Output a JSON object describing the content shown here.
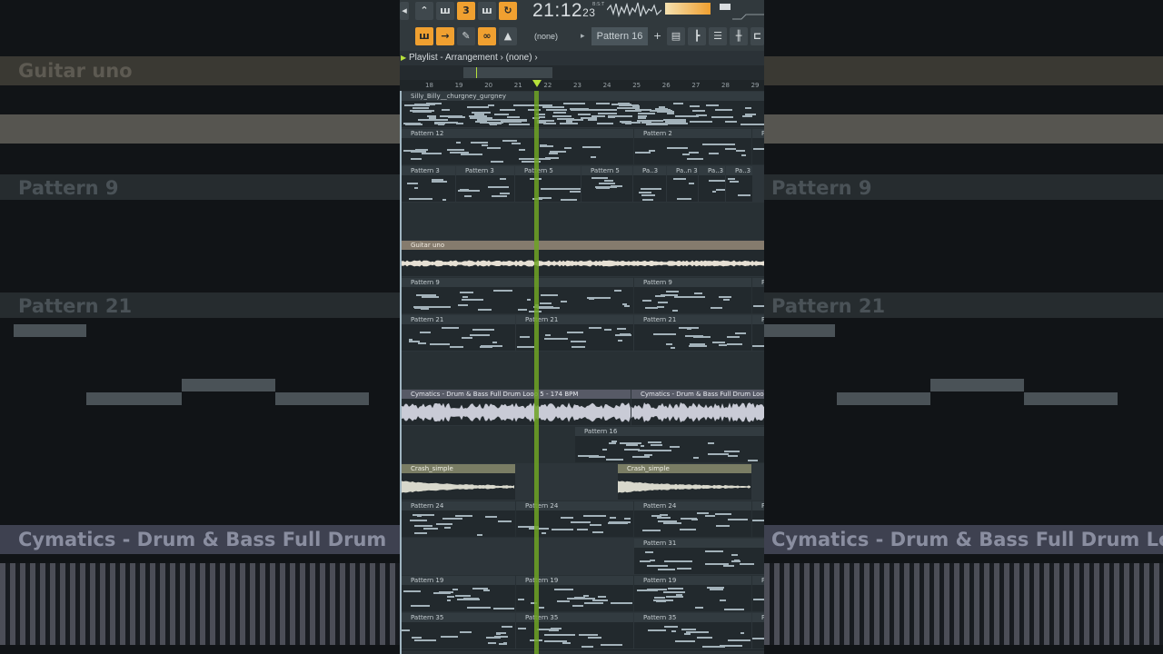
{
  "toolbar": {
    "clock": {
      "time": "21:12",
      "seconds": "23",
      "tag": "B:S:T"
    },
    "none_label": "(none)",
    "pattern_label": "Pattern 16",
    "plus_label": "+"
  },
  "playlist": {
    "title": "Playlist - Arrangement",
    "sep": "›",
    "context": "(none)"
  },
  "ruler": [
    "18",
    "19",
    "20",
    "21",
    "22",
    "23",
    "24",
    "25",
    "26",
    "27",
    "28",
    "29"
  ],
  "tracks": [
    {
      "clips": [
        {
          "label": "Silly_Billy__churgney_gurgney",
          "type": "dense"
        }
      ]
    },
    {
      "clips": [
        {
          "label": "Pattern 12",
          "type": "pattern"
        },
        {
          "label": "Pattern 2",
          "type": "pattern"
        },
        {
          "label": "P",
          "type": "pattern"
        }
      ]
    },
    {
      "clips": [
        {
          "label": "Pattern 3",
          "type": "pattern"
        },
        {
          "label": "Pattern 3",
          "type": "pattern"
        },
        {
          "label": "Pattern 5",
          "type": "pattern"
        },
        {
          "label": "Pattern 5",
          "type": "pattern"
        },
        {
          "label": "Pa..3",
          "type": "pattern"
        },
        {
          "label": "Pa..n 3",
          "type": "pattern"
        },
        {
          "label": "Pa..3",
          "type": "pattern"
        },
        {
          "label": "Pa..3",
          "type": "pattern"
        }
      ]
    },
    {
      "clips": []
    },
    {
      "clips": [
        {
          "label": "Guitar uno",
          "type": "guitar"
        }
      ]
    },
    {
      "clips": [
        {
          "label": "Pattern 9",
          "type": "pattern"
        },
        {
          "label": "Pattern 9",
          "type": "pattern"
        },
        {
          "label": "P",
          "type": "pattern"
        }
      ]
    },
    {
      "clips": [
        {
          "label": "Pattern 21",
          "type": "pattern"
        },
        {
          "label": "Pattern 21",
          "type": "pattern"
        },
        {
          "label": "Pattern 21",
          "type": "pattern"
        },
        {
          "label": "P",
          "type": "pattern"
        }
      ]
    },
    {
      "clips": []
    },
    {
      "clips": [
        {
          "label": "Cymatics - Drum & Bass Full Drum Loop 5 - 174 BPM",
          "type": "audio"
        },
        {
          "label": "Cymatics - Drum & Bass Full Drum Loo",
          "type": "audio"
        }
      ]
    },
    {
      "clips": [
        {
          "label": "Pattern 16",
          "type": "pattern"
        }
      ]
    },
    {
      "clips": [
        {
          "label": "Crash_simple",
          "type": "crash"
        },
        {
          "label": "Crash_simple",
          "type": "crash"
        }
      ]
    },
    {
      "clips": [
        {
          "label": "Pattern 24",
          "type": "pattern"
        },
        {
          "label": "Pattern 24",
          "type": "pattern"
        },
        {
          "label": "Pattern 24",
          "type": "pattern"
        },
        {
          "label": "P",
          "type": "pattern"
        }
      ]
    },
    {
      "clips": [
        {
          "label": "Pattern 31",
          "type": "pattern"
        }
      ]
    },
    {
      "clips": [
        {
          "label": "Pattern 19",
          "type": "pattern"
        },
        {
          "label": "Pattern 19",
          "type": "pattern"
        },
        {
          "label": "Pattern 19",
          "type": "pattern"
        },
        {
          "label": "P",
          "type": "pattern"
        }
      ]
    },
    {
      "clips": [
        {
          "label": "Pattern 35",
          "type": "pattern"
        },
        {
          "label": "Pattern 35",
          "type": "pattern"
        },
        {
          "label": "Pattern 35",
          "type": "pattern"
        },
        {
          "label": "P",
          "type": "pattern"
        }
      ]
    }
  ],
  "background": {
    "left_labels": [
      "Guitar uno",
      "Pattern 9",
      "Pattern 21"
    ],
    "right_labels": [
      "Pattern 9",
      "Pattern 21"
    ],
    "bottom_left": "Cymatics - Drum & Bass Full Drum",
    "bottom_right": "Cymatics - Drum & Bass Full Drum Loo"
  },
  "colors": {
    "accent": "#f0a030",
    "playhead": "#6ea324"
  }
}
